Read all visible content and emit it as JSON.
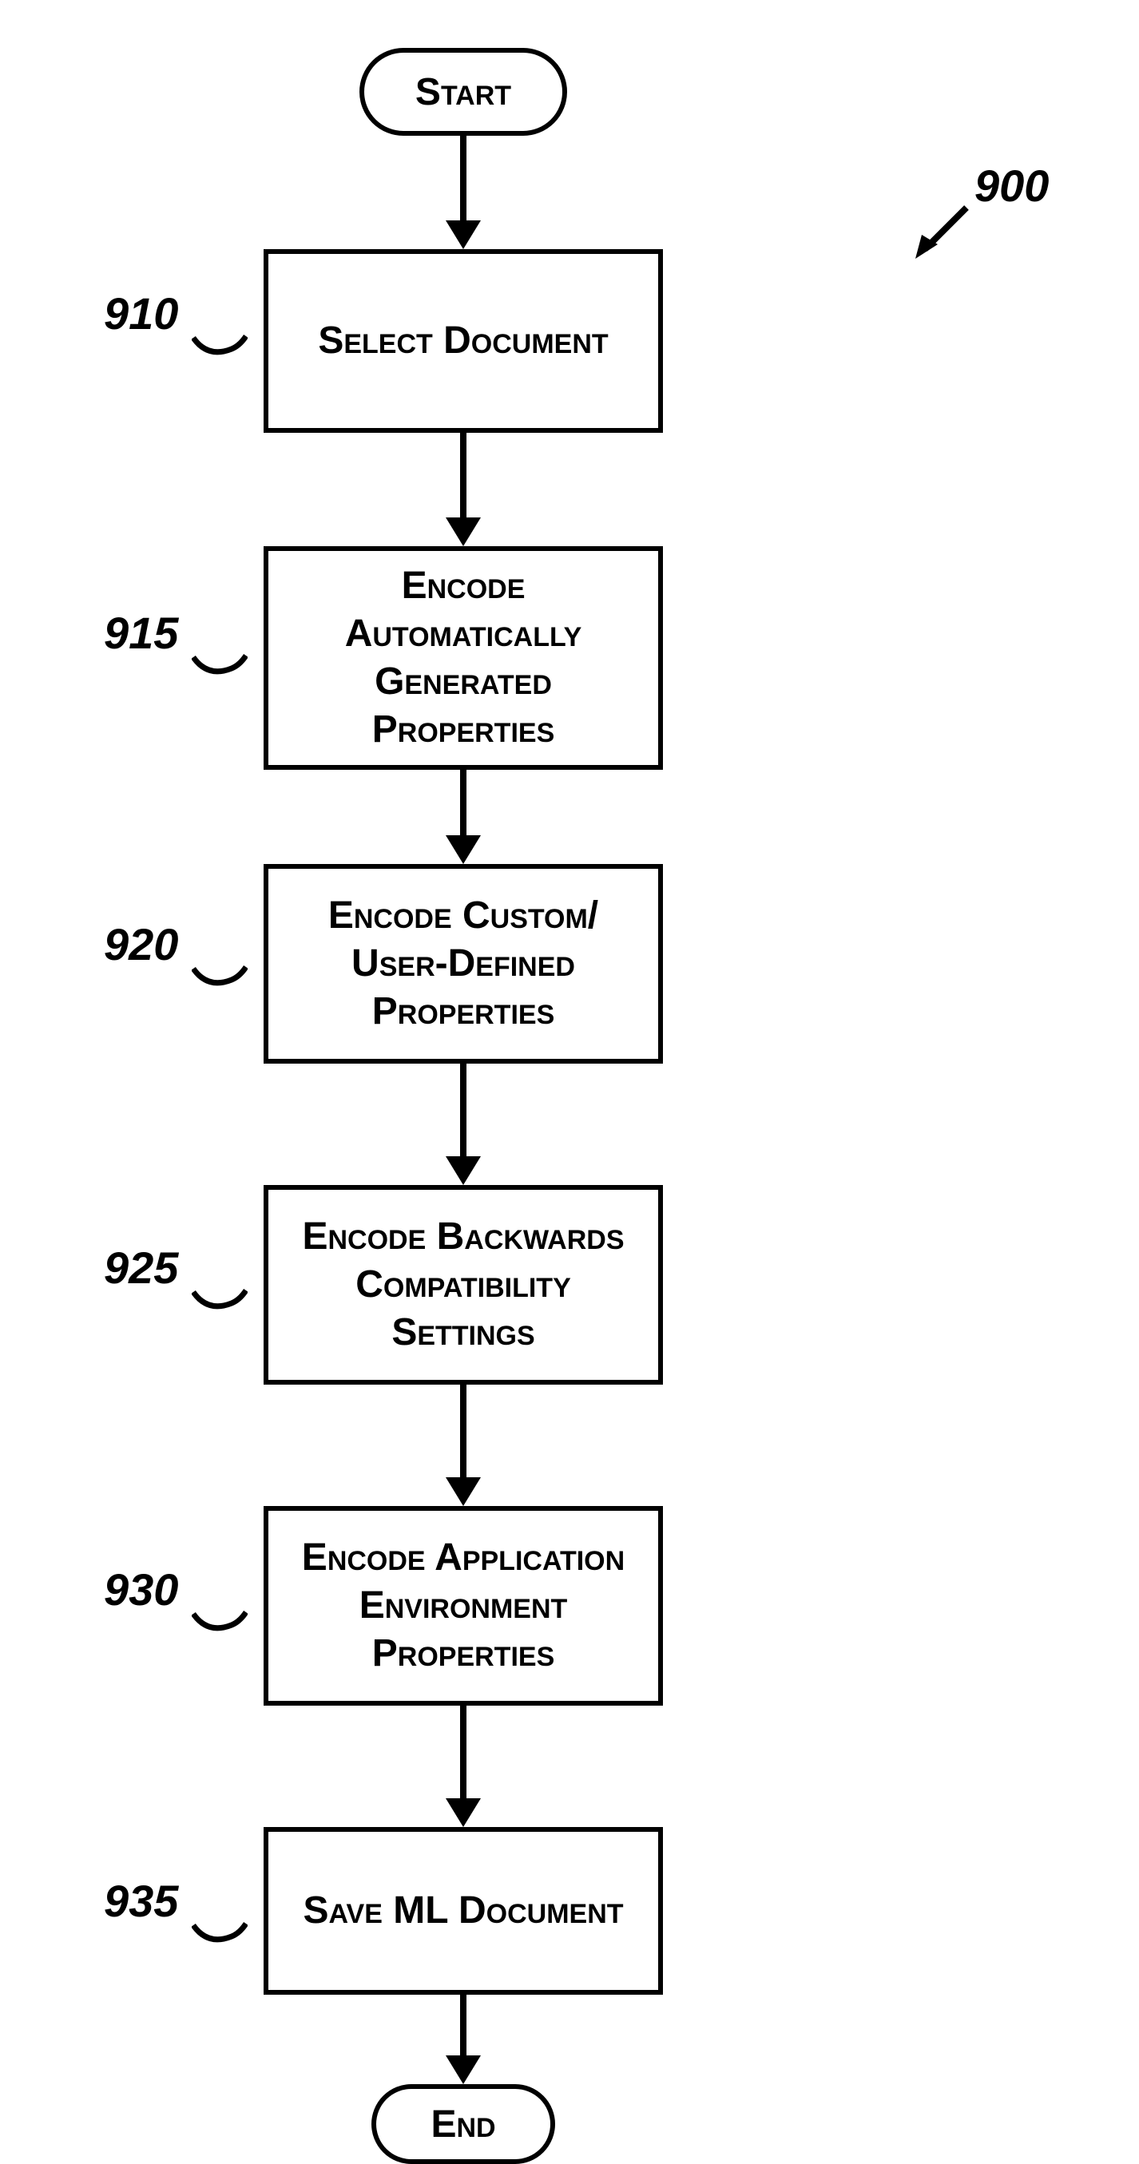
{
  "terminators": {
    "start": "Start",
    "end": "End"
  },
  "steps": {
    "s910": {
      "ref": "910",
      "text": "Select Document"
    },
    "s915": {
      "ref": "915",
      "text": "Encode Automatically Generated Properties"
    },
    "s920": {
      "ref": "920",
      "text": "Encode Custom/\nUser-Defined Properties"
    },
    "s925": {
      "ref": "925",
      "text": "Encode Backwards Compatibility Settings"
    },
    "s930": {
      "ref": "930",
      "text": "Encode Application Environment Properties"
    },
    "s935": {
      "ref": "935",
      "text": "Save ML Document"
    }
  },
  "figure_ref": "900"
}
